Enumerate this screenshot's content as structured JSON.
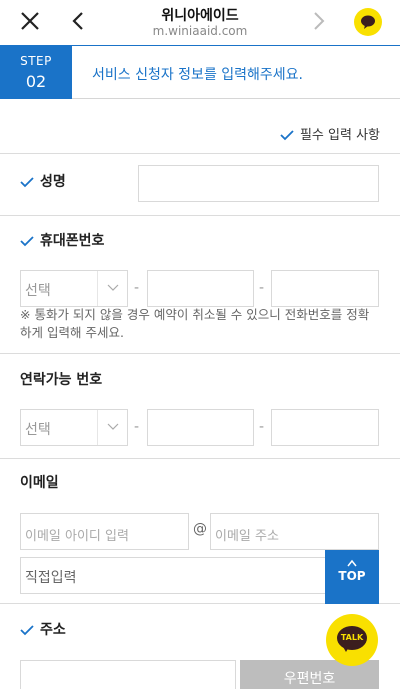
{
  "browser": {
    "title": "위니아에이드",
    "url": "m.winiaaid.com"
  },
  "step": {
    "label": "STEP",
    "number": "02",
    "message": "서비스 신청자 정보를 입력해주세요."
  },
  "required_note": "필수 입력 사항",
  "fields": {
    "name": {
      "label": "성명",
      "value": ""
    },
    "mobile": {
      "label": "휴대폰번호",
      "select_value": "선택",
      "separator": "-",
      "note": "※ 통화가 되지 않을 경우 예약이 취소될 수 있으니 전화번호를 정확하게 입력해 주세요."
    },
    "contact": {
      "label": "연락가능 번호",
      "select_value": "선택",
      "separator": "-"
    },
    "email": {
      "label": "이메일",
      "id_placeholder": "이메일 아이디 입력",
      "at": "@",
      "domain_placeholder": "이메일 주소",
      "direct_input": "직접입력"
    },
    "address": {
      "label": "주소",
      "postal_button": "우편번호"
    }
  },
  "floating": {
    "top_label": "TOP",
    "talk_label": "TALK"
  },
  "colors": {
    "accent": "#1a73c8",
    "kakao": "#f9e000"
  }
}
